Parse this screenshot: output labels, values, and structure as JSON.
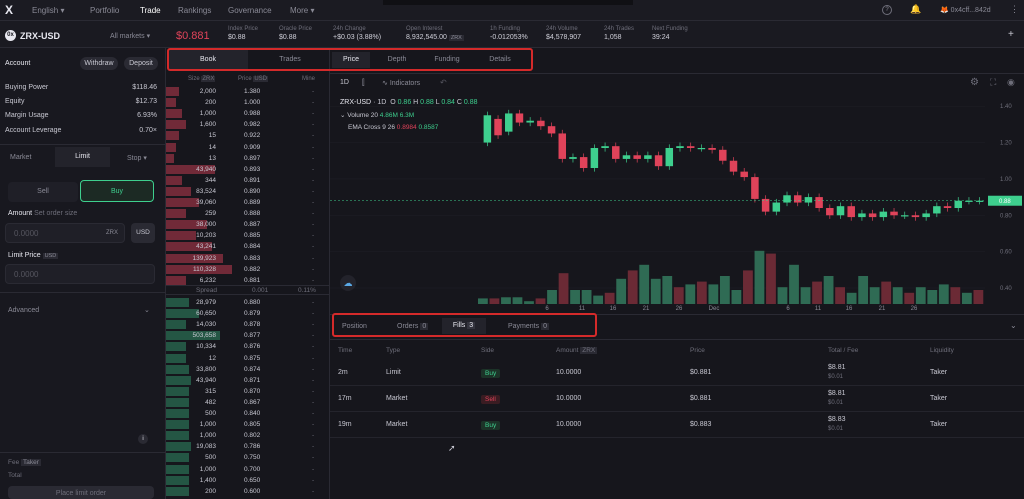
{
  "topbar": {
    "logo": "X",
    "language": "English",
    "nav": [
      "Portfolio",
      "Trade",
      "Rankings",
      "Governance",
      "More"
    ],
    "account": "0x4cff...842d"
  },
  "market": {
    "name": "ZRX-USD",
    "all_markets": "All markets",
    "price": "$0.881"
  },
  "stats": [
    {
      "label": "Index Price",
      "value": "$0.88"
    },
    {
      "label": "Oracle Price",
      "value": "$0.88"
    },
    {
      "label": "24h Change",
      "value": "+$0.03 (3.88%)"
    },
    {
      "label": "Open Interest",
      "value": "8,932,545.00",
      "badge": "ZRX"
    },
    {
      "label": "1h Funding",
      "value": "-0.012053%"
    },
    {
      "label": "24h Volume",
      "value": "$4,578,907"
    },
    {
      "label": "24h Trades",
      "value": "1,058"
    },
    {
      "label": "Next Funding",
      "value": "39:24"
    }
  ],
  "account": {
    "title": "Account",
    "withdraw": "Withdraw",
    "deposit": "Deposit",
    "rows": [
      [
        "Buying Power",
        "$118.46"
      ],
      [
        "Equity",
        "$12.73"
      ],
      [
        "Margin Usage",
        "6.93%"
      ],
      [
        "Account Leverage",
        "0.70×"
      ]
    ]
  },
  "order": {
    "tabs": [
      "Market",
      "Limit",
      "Stop"
    ],
    "sell": "Sell",
    "buy": "Buy",
    "amount_label": "Amount",
    "amount_hint": "Set order size",
    "amount_placeholder": "0.0000",
    "amount_unit": "ZRX",
    "usd": "USD",
    "limit_label": "Limit Price",
    "limit_unit": "USD",
    "limit_placeholder": "0.0000",
    "advanced": "Advanced",
    "fee": "Fee",
    "fee_badge": "Taker",
    "total": "Total",
    "place": "Place limit order",
    "info": "i"
  },
  "book": {
    "tabs": [
      "Book",
      "Trades"
    ],
    "headers": [
      "Size",
      "Price",
      "Mine"
    ],
    "size_unit": "ZRX",
    "price_unit": "USD",
    "asks": [
      [
        "2,000",
        "1.380"
      ],
      [
        "200",
        "1.000"
      ],
      [
        "1,000",
        "0.988"
      ],
      [
        "1,600",
        "0.982"
      ],
      [
        "15",
        "0.922"
      ],
      [
        "14",
        "0.909"
      ],
      [
        "13",
        "0.897"
      ],
      [
        "43,940",
        "0.893"
      ],
      [
        "344",
        "0.891"
      ],
      [
        "83,524",
        "0.890"
      ],
      [
        "39,060",
        "0.889"
      ],
      [
        "259",
        "0.888"
      ],
      [
        "38,000",
        "0.887"
      ],
      [
        "10,203",
        "0.885"
      ],
      [
        "43,241",
        "0.884"
      ],
      [
        "139,923",
        "0.883"
      ],
      [
        "110,328",
        "0.882"
      ],
      [
        "6,232",
        "0.881"
      ]
    ],
    "ask_fill": [
      0.08,
      0.06,
      0.1,
      0.12,
      0.08,
      0.06,
      0.05,
      0.3,
      0.1,
      0.15,
      0.2,
      0.12,
      0.25,
      0.18,
      0.28,
      0.35,
      0.4,
      0.12
    ],
    "spread": {
      "label": "Spread",
      "value": "0.001",
      "pct": "0.11%"
    },
    "bids": [
      [
        "28,979",
        "0.880"
      ],
      [
        "60,650",
        "0.879"
      ],
      [
        "14,030",
        "0.878"
      ],
      [
        "503,658",
        "0.877"
      ],
      [
        "10,334",
        "0.876"
      ],
      [
        "12",
        "0.875"
      ],
      [
        "33,800",
        "0.874"
      ],
      [
        "43,940",
        "0.871"
      ],
      [
        "315",
        "0.870"
      ],
      [
        "482",
        "0.867"
      ],
      [
        "500",
        "0.840"
      ],
      [
        "1,000",
        "0.805"
      ],
      [
        "1,000",
        "0.802"
      ],
      [
        "19,083",
        "0.786"
      ],
      [
        "500",
        "0.750"
      ],
      [
        "1,000",
        "0.700"
      ],
      [
        "1,400",
        "0.650"
      ],
      [
        "200",
        "0.600"
      ]
    ],
    "bid_fill": [
      0.14,
      0.2,
      0.12,
      0.33,
      0.12,
      0.12,
      0.14,
      0.15,
      0.14,
      0.14,
      0.14,
      0.14,
      0.14,
      0.15,
      0.14,
      0.14,
      0.14,
      0.14
    ],
    "mine": "-"
  },
  "chart_tabs": [
    "Price",
    "Depth",
    "Funding",
    "Details"
  ],
  "chart": {
    "toolbar": {
      "interval": "1D",
      "indicators": "Indicators"
    },
    "legend": {
      "symbol": "ZRX-USD",
      "interval": "1D",
      "o": "0.86",
      "h": "0.88",
      "l": "0.84",
      "c": "0.88",
      "volume_label": "Volume 20",
      "vol1": "4.86M",
      "vol2": "6.3M",
      "ema_label": "EMA Cross 9 26",
      "ema1": "0.8984",
      "ema2": "0.8587"
    },
    "yticks": [
      "1.40",
      "1.20",
      "1.00",
      "0.80",
      "0.60",
      "0.40"
    ],
    "last": "0.88",
    "xticks": [
      "6",
      "11",
      "16",
      "21",
      "26",
      "Dec",
      "6",
      "11",
      "16",
      "21",
      "26"
    ]
  },
  "chart_data": {
    "type": "candlestick",
    "x": [
      "Nov 4",
      "Nov 5",
      "Nov 6",
      "Nov 7",
      "Nov 8",
      "Nov 9",
      "Nov 10",
      "Nov 11",
      "Nov 12",
      "Nov 13",
      "Nov 14",
      "Nov 15",
      "Nov 16",
      "Nov 17",
      "Nov 18",
      "Nov 19",
      "Nov 20",
      "Nov 21",
      "Nov 22",
      "Nov 23",
      "Nov 24",
      "Nov 25",
      "Nov 26",
      "Nov 27",
      "Nov 28",
      "Nov 29",
      "Nov 30",
      "Dec 1",
      "Dec 2",
      "Dec 3",
      "Dec 4",
      "Dec 5",
      "Dec 6",
      "Dec 7",
      "Dec 8",
      "Dec 9",
      "Dec 10",
      "Dec 11",
      "Dec 12",
      "Dec 13",
      "Dec 14",
      "Dec 15",
      "Dec 16",
      "Dec 17",
      "Dec 18",
      "Dec 19",
      "Dec 20",
      "Dec 21",
      "Dec 22",
      "Dec 23",
      "Dec 24",
      "Dec 25",
      "Dec 26",
      "Dec 27"
    ],
    "candles": [
      [
        1.2,
        1.35
      ],
      [
        1.33,
        1.24
      ],
      [
        1.26,
        1.36
      ],
      [
        1.36,
        1.31
      ],
      [
        1.31,
        1.32
      ],
      [
        1.32,
        1.29
      ],
      [
        1.29,
        1.25
      ],
      [
        1.25,
        1.11
      ],
      [
        1.11,
        1.12
      ],
      [
        1.12,
        1.06
      ],
      [
        1.06,
        1.17
      ],
      [
        1.17,
        1.18
      ],
      [
        1.18,
        1.11
      ],
      [
        1.11,
        1.13
      ],
      [
        1.13,
        1.11
      ],
      [
        1.11,
        1.13
      ],
      [
        1.13,
        1.07
      ],
      [
        1.07,
        1.17
      ],
      [
        1.17,
        1.18
      ],
      [
        1.18,
        1.17
      ],
      [
        1.17,
        1.17
      ],
      [
        1.17,
        1.16
      ],
      [
        1.16,
        1.1
      ],
      [
        1.1,
        1.04
      ],
      [
        1.04,
        1.01
      ],
      [
        1.01,
        0.89
      ],
      [
        0.89,
        0.82
      ],
      [
        0.82,
        0.87
      ],
      [
        0.87,
        0.91
      ],
      [
        0.91,
        0.87
      ],
      [
        0.87,
        0.9
      ],
      [
        0.9,
        0.84
      ],
      [
        0.84,
        0.8
      ],
      [
        0.8,
        0.85
      ],
      [
        0.85,
        0.79
      ],
      [
        0.79,
        0.81
      ],
      [
        0.81,
        0.79
      ],
      [
        0.79,
        0.82
      ],
      [
        0.82,
        0.8
      ],
      [
        0.8,
        0.8
      ],
      [
        0.8,
        0.79
      ],
      [
        0.79,
        0.81
      ],
      [
        0.81,
        0.85
      ],
      [
        0.85,
        0.84
      ],
      [
        0.84,
        0.88
      ],
      [
        0.88,
        0.88
      ],
      [
        0.88,
        0.88
      ]
    ],
    "volume": [
      0.1,
      0.1,
      0.12,
      0.12,
      0.05,
      0.1,
      0.25,
      0.55,
      0.25,
      0.25,
      0.15,
      0.2,
      0.45,
      0.6,
      0.7,
      0.45,
      0.5,
      0.3,
      0.35,
      0.4,
      0.35,
      0.5,
      0.25,
      0.6,
      0.95,
      0.9,
      0.3,
      0.7,
      0.3,
      0.4,
      0.5,
      0.3,
      0.2,
      0.5,
      0.3,
      0.4,
      0.3,
      0.2,
      0.3,
      0.25,
      0.35,
      0.3,
      0.2,
      0.25
    ],
    "ylim": [
      0.4,
      1.5
    ]
  },
  "trades": {
    "tabs": [
      "Position",
      "Orders",
      "Fills",
      "Payments"
    ],
    "counts": [
      "0",
      "3",
      "0"
    ],
    "headers": [
      "Time",
      "Type",
      "Side",
      "Amount",
      "Price",
      "Total / Fee",
      "Liquidity"
    ],
    "amount_unit": "ZRX",
    "rows": [
      {
        "time": "2m",
        "type": "Limit",
        "side": "Buy",
        "amount": "10.0000",
        "price": "$0.881",
        "total": "$8.81",
        "fee": "$0.01",
        "liq": "Taker"
      },
      {
        "time": "17m",
        "type": "Market",
        "side": "Sell",
        "amount": "10.0000",
        "price": "$0.881",
        "total": "$8.81",
        "fee": "$0.01",
        "liq": "Taker"
      },
      {
        "time": "19m",
        "type": "Market",
        "side": "Buy",
        "amount": "10.0000",
        "price": "$0.883",
        "total": "$8.83",
        "fee": "$0.01",
        "liq": "Taker"
      }
    ]
  },
  "colors": {
    "up": "#3ecf8e",
    "down": "#e0435a",
    "accent": "#5c4ee5",
    "highlight": "#d42a2a"
  }
}
